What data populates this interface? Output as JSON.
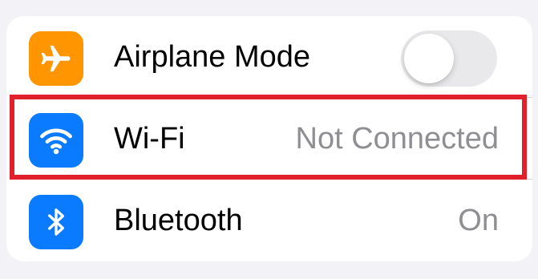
{
  "settings": {
    "rows": [
      {
        "label": "Airplane Mode",
        "icon": "airplane-icon",
        "icon_bg": "#ff9500",
        "toggle_on": false
      },
      {
        "label": "Wi-Fi",
        "icon": "wifi-icon",
        "icon_bg": "#0a7aff",
        "detail": "Not Connected"
      },
      {
        "label": "Bluetooth",
        "icon": "bluetooth-icon",
        "icon_bg": "#0a7aff",
        "detail": "On"
      }
    ]
  },
  "colors": {
    "highlight": "#e0202a",
    "secondary_text": "#8e8e93",
    "toggle_off": "#e9e9eb"
  }
}
